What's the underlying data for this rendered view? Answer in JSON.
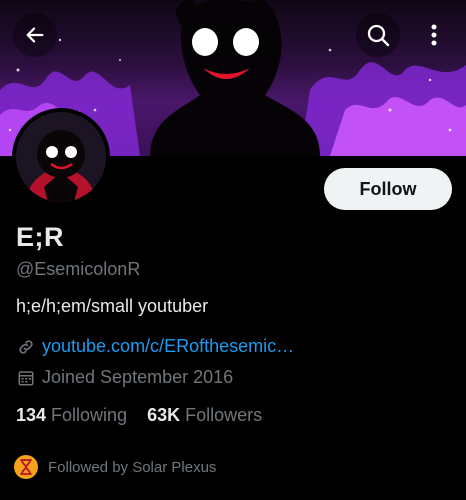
{
  "header": {
    "back_icon": "arrow-left-icon",
    "search_icon": "search-icon",
    "more_icon": "more-vertical-icon"
  },
  "profile": {
    "display_name": "E;R",
    "handle": "@EsemicolonR",
    "bio": "h;e/h;em/small youtuber",
    "link": "youtube.com/c/ERofthesemic…",
    "joined": "Joined September 2016",
    "follow_label": "Follow"
  },
  "stats": {
    "following_count": "134",
    "following_label": "Following",
    "followers_count": "63K",
    "followers_label": "Followers"
  },
  "followed_by": {
    "text": "Followed by Solar Plexus",
    "avatar_color": "#f6a21a"
  },
  "colors": {
    "accent": "#1d9bf0",
    "muted": "#71767b",
    "text": "#e7e9ea",
    "background": "#000000"
  }
}
